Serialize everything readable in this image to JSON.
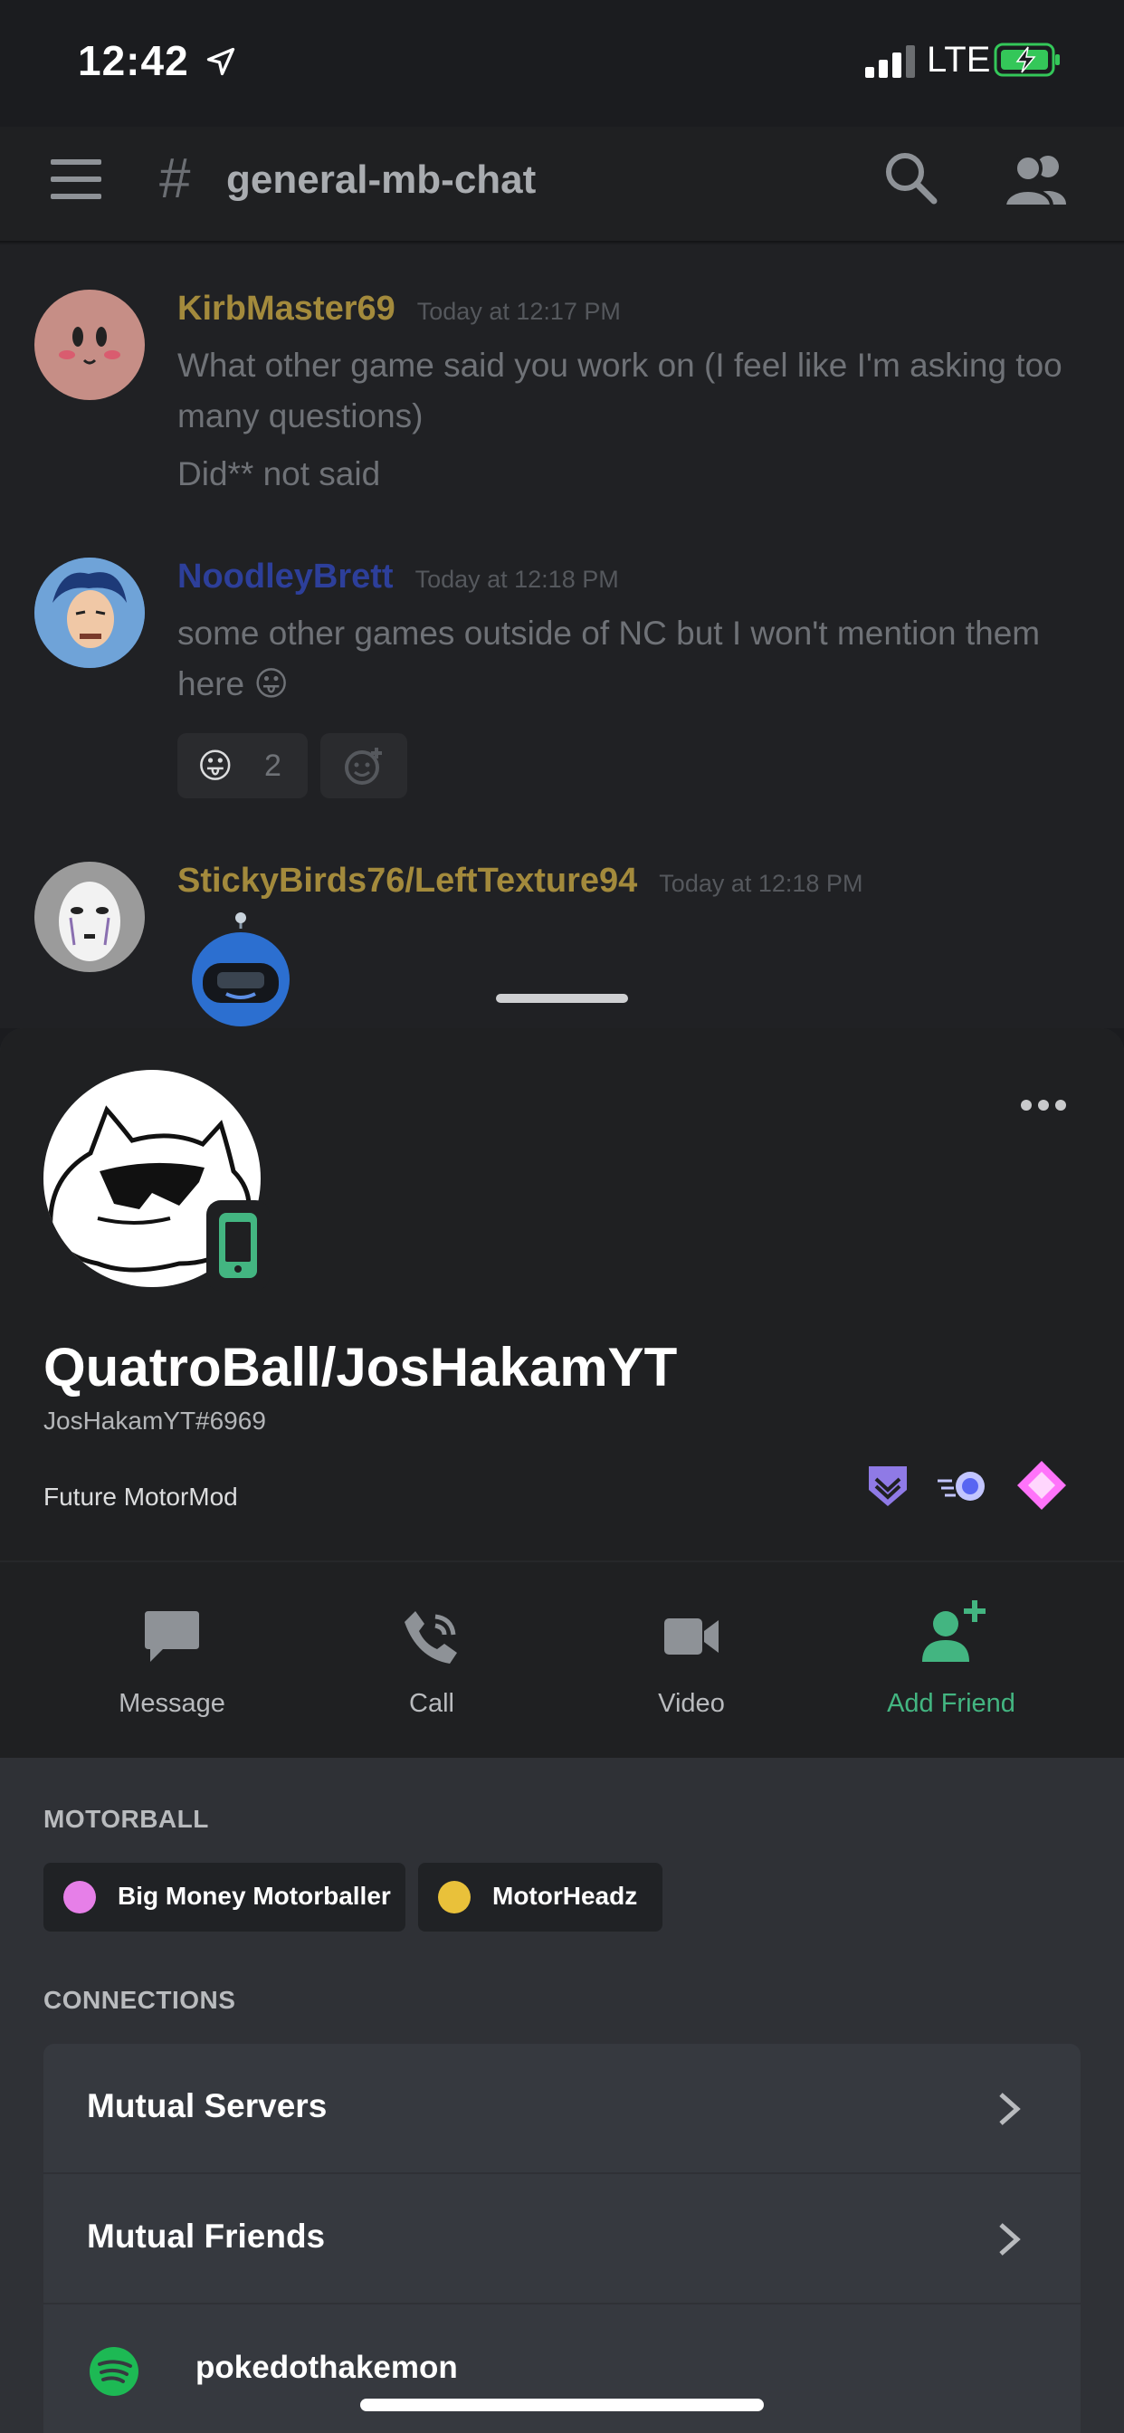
{
  "status_bar": {
    "time": "12:42",
    "network": "LTE"
  },
  "header": {
    "channel_name": "general-mb-chat"
  },
  "messages": [
    {
      "username": "KirbMaster69",
      "timestamp": "Today at 12:17 PM",
      "lines": [
        "What other game said you work on (I feel like I'm asking too many questions)",
        "Did** not said"
      ],
      "name_color": "#a38a3c"
    },
    {
      "username": "NoodleyBrett",
      "timestamp": "Today at 12:18 PM",
      "lines": [
        "some other games outside of NC but I won't mention them here 😛"
      ],
      "reaction_count": "2",
      "name_color": "#2d3f9a"
    },
    {
      "username": "StickyBirds76/LeftTexture94",
      "timestamp": "Today at 12:18 PM",
      "name_color": "#a38a3c"
    }
  ],
  "profile": {
    "display_name": "QuatroBall/JosHakamYT",
    "tag": "JosHakamYT#6969",
    "bio": "Future MotorMod",
    "actions": {
      "message": "Message",
      "call": "Call",
      "video": "Video",
      "add_friend": "Add Friend"
    },
    "roles_section": "MOTORBALL",
    "roles": [
      {
        "name": "Big Money Motorballer",
        "color": "#e67fe8"
      },
      {
        "name": "MotorHeadz",
        "color": "#e9c13a"
      }
    ],
    "connections_section": "CONNECTIONS",
    "connections": {
      "mutual_servers": "Mutual Servers",
      "mutual_friends": "Mutual Friends",
      "spotify_account": "pokedothakemon"
    }
  },
  "colors": {
    "online_green": "#43b581",
    "accent": "#5865f2",
    "spotify_green": "#1db954"
  }
}
